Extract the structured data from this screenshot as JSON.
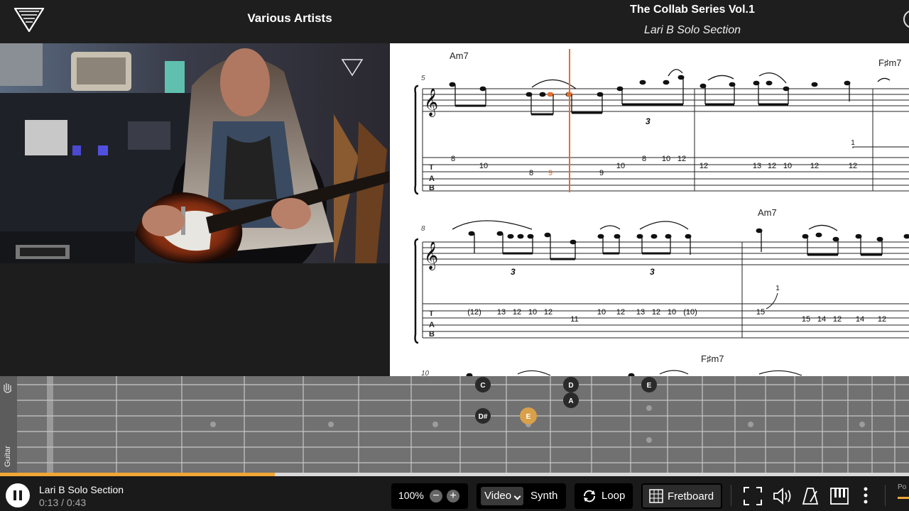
{
  "header": {
    "artist": "Various Artists",
    "song_title": "The Collab Series Vol.1",
    "section": "Lari B Solo Section"
  },
  "score": {
    "system1": {
      "measure_number": "5",
      "chords": [
        "Am7",
        "F♯m7"
      ],
      "tab_numbers": [
        "8",
        "10",
        "8",
        "9",
        "9",
        "10",
        "8",
        "10",
        "12",
        "12",
        "13",
        "12",
        "10",
        "12",
        "12",
        "1"
      ],
      "triplet": "3"
    },
    "system2": {
      "measure_number": "8",
      "chords": [
        "Am7"
      ],
      "tab_numbers": [
        "(12)",
        "13",
        "12",
        "10",
        "12",
        "11",
        "10",
        "12",
        "13",
        "12",
        "10",
        "(10)",
        "15",
        "1",
        "15",
        "14",
        "12",
        "14",
        "12"
      ],
      "triplet": "3"
    },
    "system3": {
      "measure_number": "10",
      "chords": [
        "F♯m7"
      ]
    },
    "tab_letters": [
      "T",
      "A",
      "B"
    ]
  },
  "fretboard": {
    "instrument_label": "Guitar",
    "notes": [
      {
        "label": "C",
        "highlight": false
      },
      {
        "label": "D",
        "highlight": false
      },
      {
        "label": "E",
        "highlight": false
      },
      {
        "label": "A",
        "highlight": false
      },
      {
        "label": "D#",
        "highlight": false
      },
      {
        "label": "E",
        "highlight": true
      }
    ],
    "highlight_color": "#d9a04a",
    "progress_fraction": 0.302
  },
  "player": {
    "track_title": "Lari B Solo Section",
    "time": "0:13 / 0:43",
    "zoom": "100%",
    "video_label": "Video",
    "synth_label": "Synth",
    "loop_label": "Loop",
    "fretboard_label": "Fretboard",
    "accent_color": "#f0a637"
  }
}
